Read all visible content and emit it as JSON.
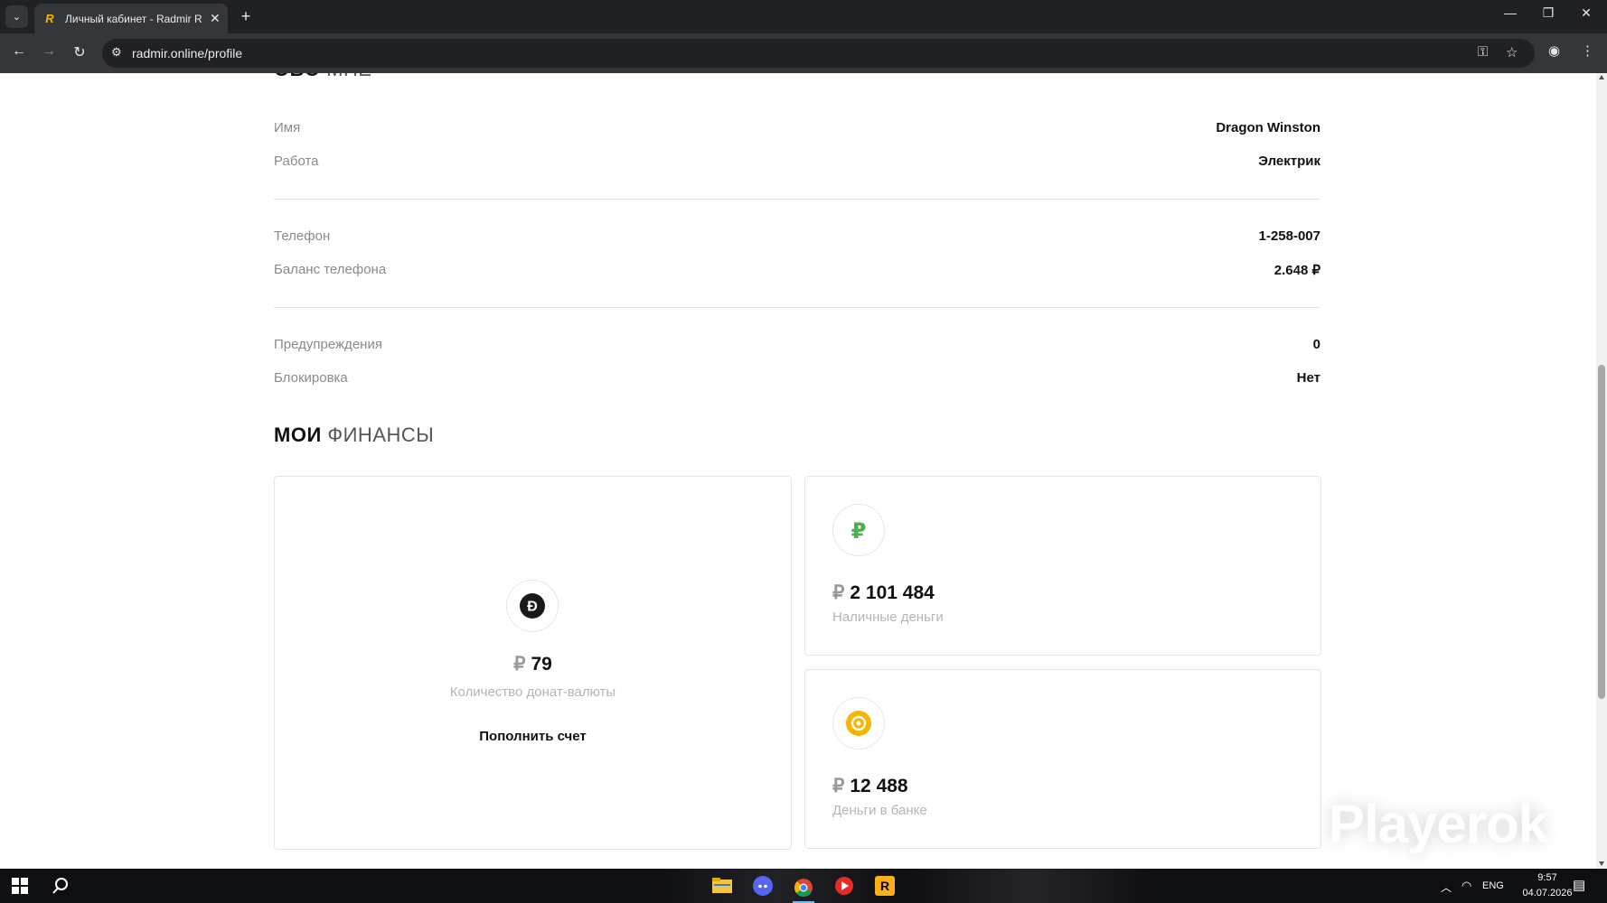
{
  "browser": {
    "tab_title": "Личный кабинет - Radmir Role",
    "url": "radmir.online/profile"
  },
  "about": {
    "title_bold": "ОБО",
    "title_light": "МНЕ",
    "rows": [
      {
        "label": "Имя",
        "value": "Dragon Winston"
      },
      {
        "label": "Работа",
        "value": "Электрик"
      },
      {
        "label": "Телефон",
        "value": "1-258-007"
      },
      {
        "label": "Баланс телефона",
        "value": "2.648 ₽"
      },
      {
        "label": "Предупреждения",
        "value": "0"
      },
      {
        "label": "Блокировка",
        "value": "Нет"
      }
    ]
  },
  "finances": {
    "title_bold": "МОИ",
    "title_light": "ФИНАНСЫ",
    "donate": {
      "currency": "₽",
      "amount": "79",
      "caption": "Количество донат-валюты",
      "action": "Пополнить счет",
      "icon": "donate-coin-icon"
    },
    "cash": {
      "currency": "₽",
      "amount": "2 101 484",
      "caption": "Наличные деньги",
      "icon": "ruble-icon",
      "icon_color": "#4caf50"
    },
    "bank": {
      "currency": "₽",
      "amount": "12 488",
      "caption": "Деньги в банке",
      "icon": "bank-coin-icon",
      "icon_color": "#f7b500"
    }
  },
  "watermark": "Playerok",
  "taskbar": {
    "lang": "ENG",
    "time": "9:57",
    "date": "04.07.2026"
  }
}
